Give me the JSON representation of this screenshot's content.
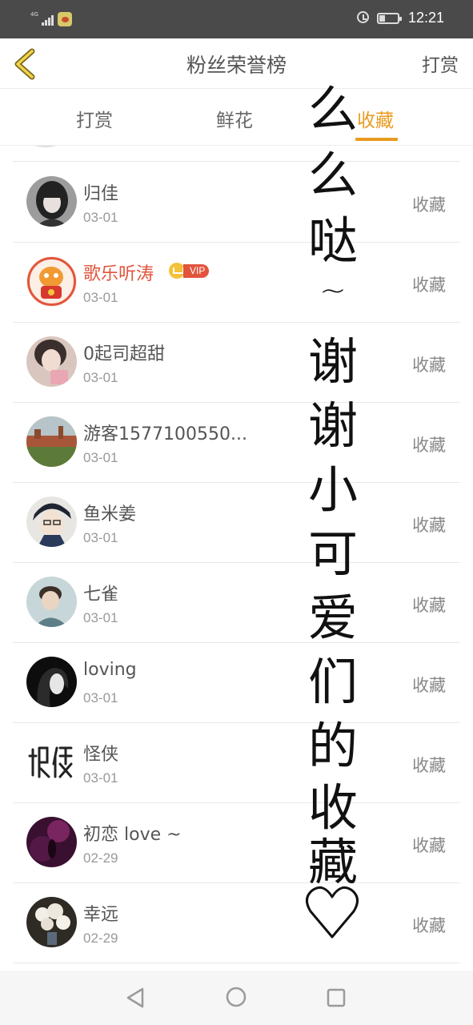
{
  "status_bar": {
    "network": "4G",
    "time": "12:21",
    "battery_level": 0.3,
    "icons": [
      "signal-icon",
      "app-notification-icon",
      "alarm-icon",
      "battery-icon"
    ]
  },
  "header": {
    "title": "粉丝荣誉榜",
    "right_action": "打赏",
    "back_icon": "chevron-left-icon"
  },
  "tabs": [
    {
      "label": "打赏",
      "active": false
    },
    {
      "label": "鲜花",
      "active": false
    },
    {
      "label": "收藏",
      "active": true
    }
  ],
  "accent_color": "#e99b1f",
  "vip_name_color": "#e2543c",
  "list": [
    {
      "name": "归佳",
      "date": "03-01",
      "action": "收藏",
      "vip": false
    },
    {
      "name": "歌乐听涛",
      "date": "03-01",
      "action": "收藏",
      "vip": true,
      "vip_label": "VIP"
    },
    {
      "name": "0起司超甜",
      "date": "03-01",
      "action": "收藏",
      "vip": false
    },
    {
      "name": "游客1577100550...",
      "date": "03-01",
      "action": "收藏",
      "vip": false
    },
    {
      "name": "鱼米姜",
      "date": "03-01",
      "action": "收藏",
      "vip": false
    },
    {
      "name": "七雀",
      "date": "03-01",
      "action": "收藏",
      "vip": false
    },
    {
      "name": "loving",
      "date": "03-01",
      "action": "收藏",
      "vip": false
    },
    {
      "name": "怪侠",
      "date": "03-01",
      "action": "收藏",
      "vip": false
    },
    {
      "name": "初恋 love ~",
      "date": "02-29",
      "action": "收藏",
      "vip": false
    },
    {
      "name": "幸远",
      "date": "02-29",
      "action": "收藏",
      "vip": false
    }
  ],
  "overlay_handwriting": {
    "chars": [
      "么",
      "么",
      "哒",
      "~",
      "谢",
      "谢",
      "小",
      "可",
      "爱",
      "们",
      "的",
      "收",
      "藏"
    ],
    "heart": "♡"
  },
  "nav_bar": {
    "icons": [
      "nav-back-icon",
      "nav-home-icon",
      "nav-recent-icon"
    ]
  }
}
